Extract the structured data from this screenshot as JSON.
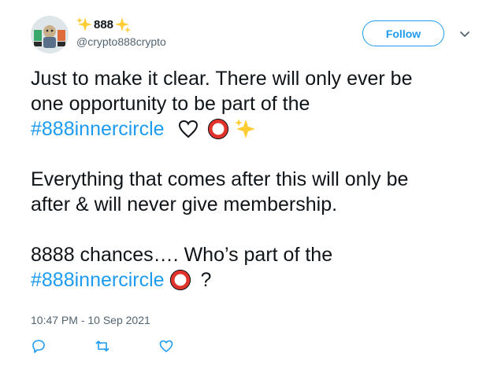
{
  "header": {
    "display_name": "888",
    "handle": "@crypto888crypto",
    "follow_label": "Follow",
    "icons": [
      "avatar-image",
      "sparkles-icon",
      "chevron-down-icon"
    ]
  },
  "tweet": {
    "line1": "Just to make it clear. There will only ever be",
    "line2": "one opportunity to be part of the",
    "hashtag": "#888innercircle",
    "line4": "Everything that comes after this will only be",
    "line5": "after & will never give membership.",
    "line6": "8888 chances…. Who’s part of the",
    "hashtag2": "#888innercircle",
    "question": "?",
    "emojis": [
      "white-heart-icon",
      "hollow-red-circle-icon",
      "sparkles-icon"
    ]
  },
  "timestamp": "10:47 PM - 10 Sep 2021",
  "actions": {
    "icons": [
      "reply-icon",
      "retweet-icon",
      "like-icon"
    ]
  },
  "colors": {
    "accent": "#1d9bf0",
    "text": "#0f1419",
    "muted": "#536471",
    "circle": "#e0332b"
  }
}
